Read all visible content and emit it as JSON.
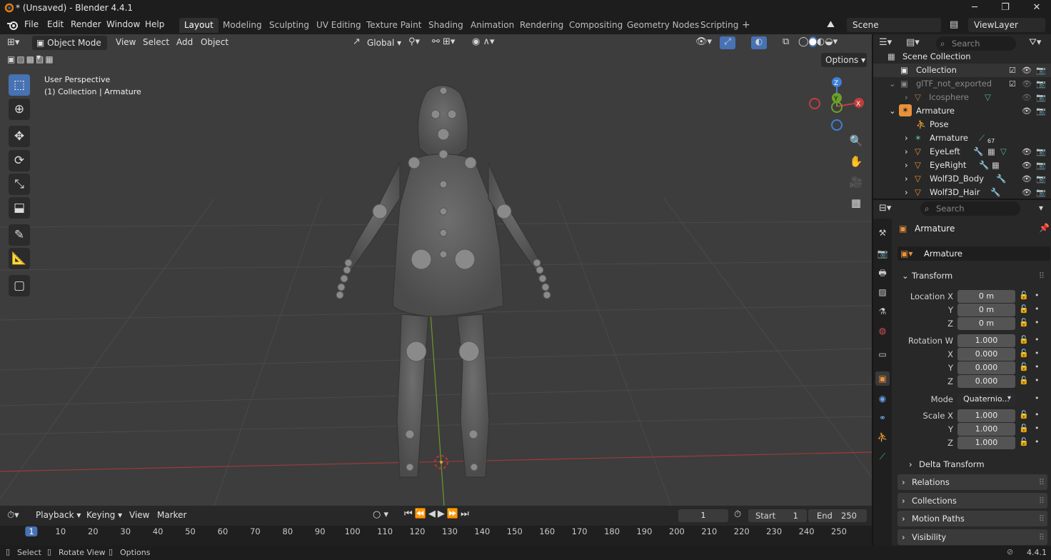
{
  "app": {
    "title": "* (Unsaved) - Blender 4.4.1",
    "window_min": "─",
    "window_max": "❐",
    "window_close": "✕",
    "version": "4.4.1"
  },
  "menu": [
    "File",
    "Edit",
    "Render",
    "Window",
    "Help"
  ],
  "workspaces": [
    "Layout",
    "Modeling",
    "Sculpting",
    "UV Editing",
    "Texture Paint",
    "Shading",
    "Animation",
    "Rendering",
    "Compositing",
    "Geometry Nodes",
    "Scripting"
  ],
  "add_workspace": "+",
  "scene": {
    "name": "Scene",
    "view_layer": "ViewLayer"
  },
  "viewport": {
    "mode": "Object Mode",
    "menus": [
      "View",
      "Select",
      "Add",
      "Object"
    ],
    "transform_orientation": "Global",
    "overlay_title": "User Perspective",
    "overlay_collection": "(1) Collection | Armature",
    "options": "Options",
    "gizmo_axes": {
      "z": "Z",
      "y": "Y",
      "x": "X"
    }
  },
  "timeline": {
    "menus": [
      "Playback",
      "Keying",
      "View",
      "Marker"
    ],
    "current_frame": "1",
    "start_label": "Start",
    "start": "1",
    "end_label": "End",
    "end": "250",
    "ruler": [
      "1",
      "10",
      "20",
      "30",
      "40",
      "50",
      "60",
      "70",
      "80",
      "90",
      "100",
      "110",
      "120",
      "130",
      "140",
      "150",
      "160",
      "170",
      "180",
      "190",
      "200",
      "210",
      "220",
      "230",
      "240",
      "250"
    ]
  },
  "status": {
    "select": "Select",
    "rotate": "Rotate View",
    "options": "Options"
  },
  "outliner": {
    "search_placeholder": "Search",
    "rows": [
      {
        "label": "Scene Collection"
      },
      {
        "label": "Collection"
      },
      {
        "label": "glTF_not_exported"
      },
      {
        "label": "Icosphere"
      },
      {
        "label": "Armature"
      },
      {
        "label": "Pose"
      },
      {
        "label": "Armature",
        "badge": "67"
      },
      {
        "label": "EyeLeft"
      },
      {
        "label": "EyeRight"
      },
      {
        "label": "Wolf3D_Body"
      },
      {
        "label": "Wolf3D_Hair"
      }
    ]
  },
  "properties": {
    "search_placeholder": "Search",
    "object_name": "Armature",
    "datablock": "Armature",
    "transform_label": "Transform",
    "location": {
      "label": "Location X",
      "x": "0 m",
      "y": "0 m",
      "z": "0 m"
    },
    "rotation": {
      "label": "Rotation W",
      "w": "1.000",
      "x": "0.000",
      "y": "0.000",
      "z": "0.000"
    },
    "mode_label": "Mode",
    "mode": "Quaternio...",
    "scale": {
      "label": "Scale X",
      "x": "1.000",
      "y": "1.000",
      "z": "1.000"
    },
    "axis": {
      "x": "X",
      "y": "Y",
      "z": "Z"
    },
    "delta_transform": "Delta Transform",
    "panels": [
      "Relations",
      "Collections",
      "Motion Paths",
      "Visibility"
    ]
  },
  "colors": {
    "accent": "#4772b3",
    "x_axis": "#c33d3d",
    "y_axis": "#6ba12a",
    "z_axis": "#3f7fd6",
    "object_orange": "#e8913a",
    "bone_green": "#4fb39a"
  }
}
